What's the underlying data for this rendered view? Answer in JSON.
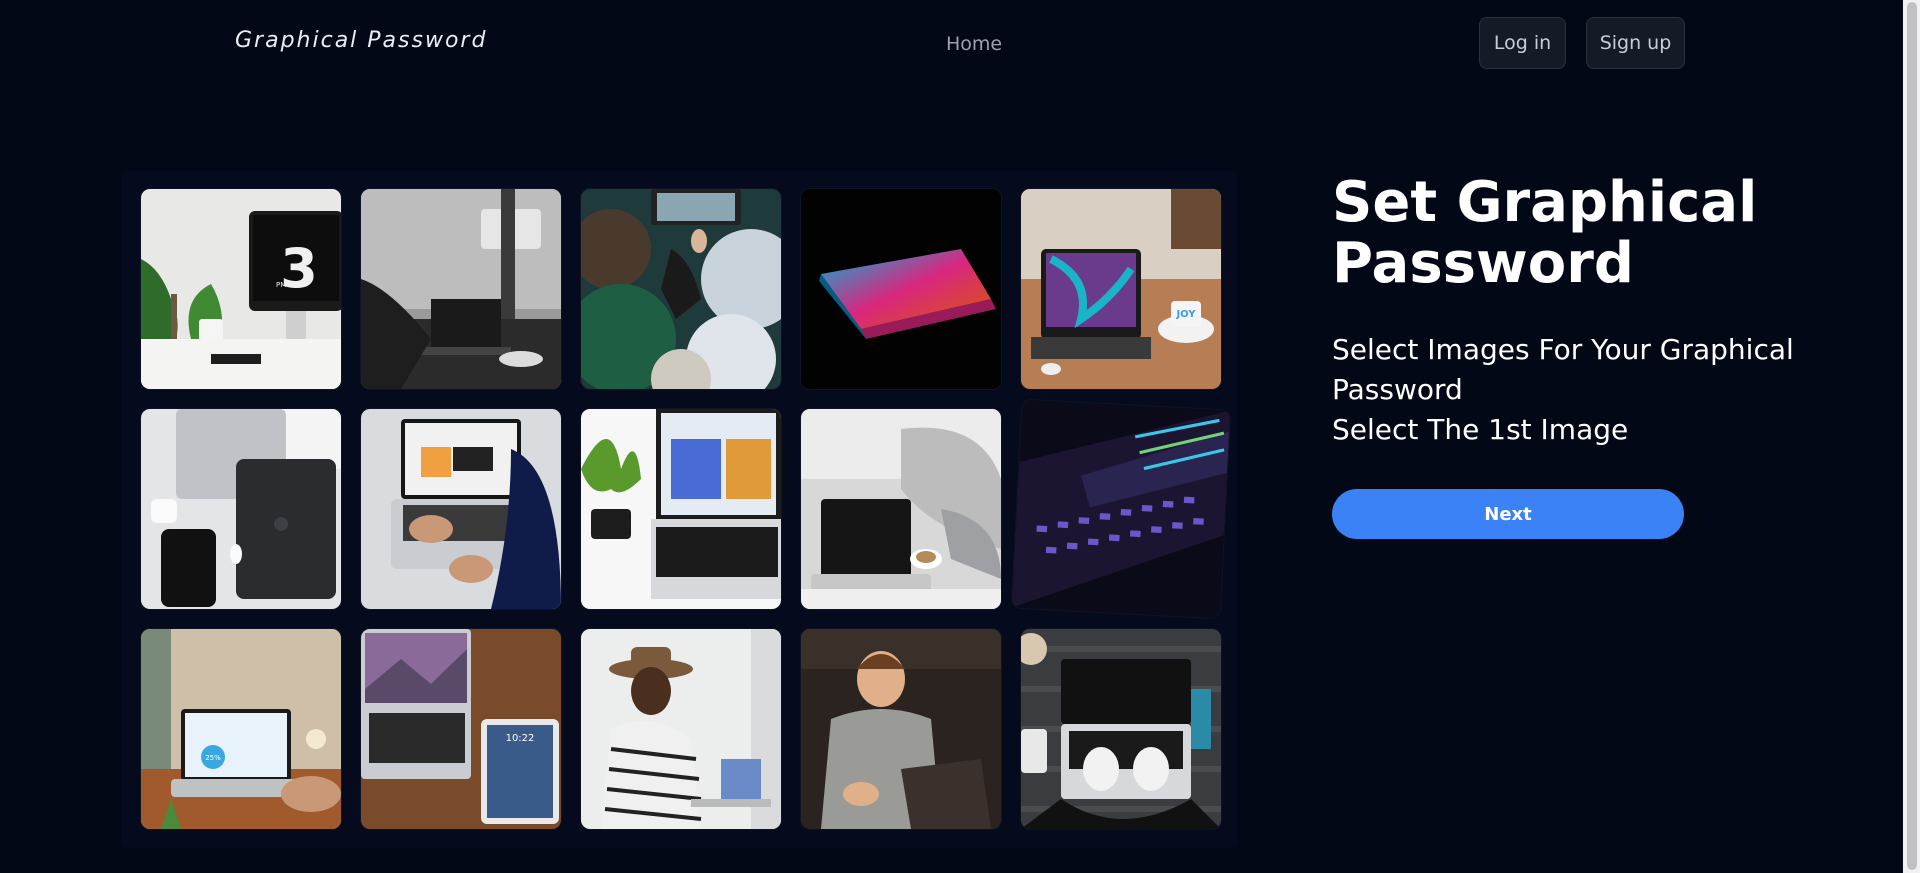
{
  "header": {
    "brand": "Graphical Password",
    "nav": {
      "home": "Home"
    },
    "login_label": "Log in",
    "signup_label": "Sign up"
  },
  "main": {
    "title": "Set Graphical Password",
    "instructions_line1": "Select Images For Your Graphical Password",
    "instructions_line2": "Select The 1st Image",
    "next_label": "Next"
  },
  "tile_clock_text": "3",
  "tile_clock_pm": "PM",
  "tile_ipad_clock": "10:22",
  "tile_screen_text": "25%"
}
